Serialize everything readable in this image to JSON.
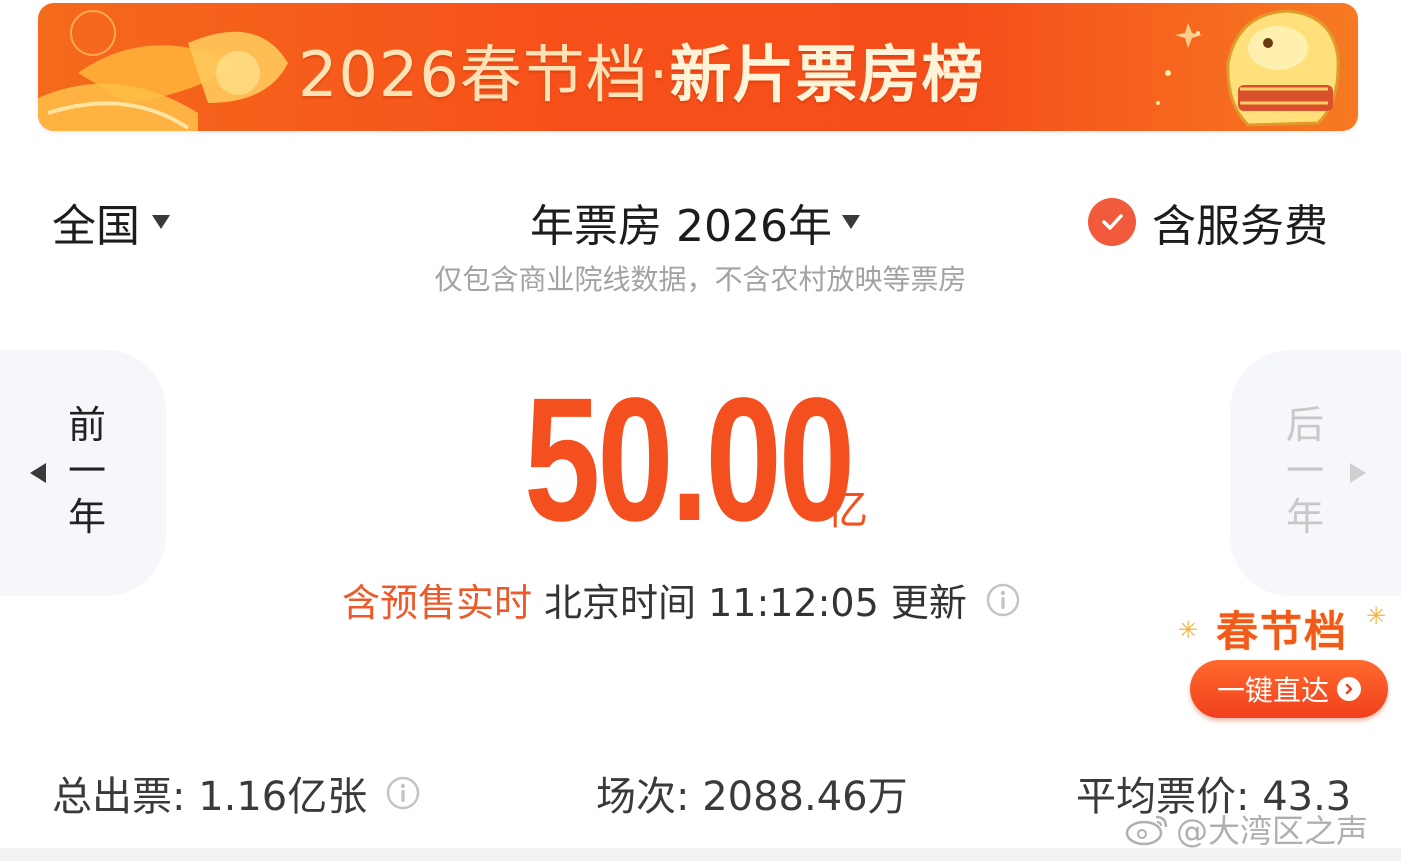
{
  "banner": {
    "title_part1": "2026春节档·",
    "title_part2": "新片票房榜"
  },
  "header": {
    "region": "全国",
    "year_select": "年票房 2026年",
    "service_fee_label": "含服务费",
    "service_fee_checked": true,
    "note": "仅包含商业院线数据，不含农村放映等票房"
  },
  "nav": {
    "prev_year": [
      "前",
      "一",
      "年"
    ],
    "next_year": [
      "后",
      "一",
      "年"
    ],
    "next_disabled": true
  },
  "box_office": {
    "value": "50.00",
    "unit": "亿",
    "presale_label": "含预售实时",
    "update_text": "北京时间 11:12:05 更新"
  },
  "spring_badge": {
    "title": "春节档",
    "button": "一键直达"
  },
  "stats": {
    "tickets": "总出票: 1.16亿张",
    "shows": "场次: 2088.46万",
    "avg_price": "平均票价: 43.3"
  },
  "watermark": "@大湾区之声",
  "colors": {
    "accent": "#f4501f",
    "banner": "#f7501a",
    "muted_text": "#a3a3a3"
  }
}
